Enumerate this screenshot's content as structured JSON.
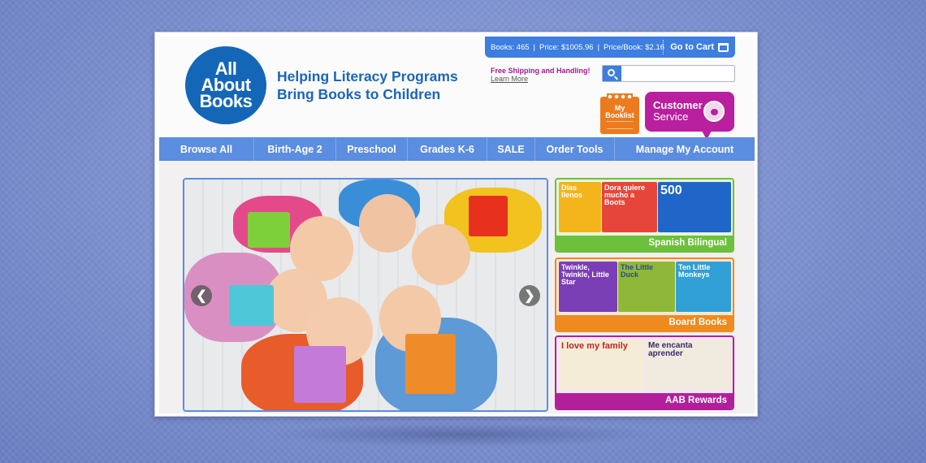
{
  "brand": {
    "logo_line1": "All",
    "logo_line2": "About",
    "logo_line3": "Books",
    "tagline_line1": "Helping Literacy Programs",
    "tagline_line2": "Bring Books to Children"
  },
  "cart": {
    "books_label": "Books: 465",
    "price_label": "Price: $1005.96",
    "price_per_book_label": "Price/Book: $2.16",
    "separator": "|",
    "go_to_cart": "Go to Cart"
  },
  "shipping": {
    "text": "Free Shipping and Handling!",
    "link": "Learn More"
  },
  "search": {
    "placeholder": "",
    "value": ""
  },
  "booklist": {
    "line1": "My",
    "line2": "Booklist"
  },
  "customer_service": {
    "line1": "Customer",
    "line2": "Service"
  },
  "nav": {
    "items": [
      {
        "label": "Browse All"
      },
      {
        "label": "Birth-Age 2"
      },
      {
        "label": "Preschool"
      },
      {
        "label": "Grades K-6"
      },
      {
        "label": "SALE"
      },
      {
        "label": "Order Tools"
      },
      {
        "label": "Manage My Account"
      }
    ]
  },
  "hero": {
    "prev": "❮",
    "next": "❯"
  },
  "tiles": [
    {
      "label": "Spanish Bilingual",
      "color": "#6cc03c"
    },
    {
      "label": "Board Books",
      "color": "#ef8a1f"
    },
    {
      "label": "AAB Rewards",
      "color": "#b21f9a"
    }
  ],
  "tile_covers": {
    "spanish_1": "Días llenos",
    "spanish_2": "Dora quiere mucho a Boots",
    "spanish_3": "500",
    "board_1": "Twinkle, Twinkle, Little Star",
    "board_2": "The Little Duck",
    "board_3": "Ten Little Monkeys",
    "rewards_1": "I love my family",
    "rewards_2": "Me encanta aprender"
  },
  "colors": {
    "primary_blue": "#1467b7",
    "nav_blue": "#5b8de0",
    "magenta": "#b91f9e",
    "orange": "#ec7b1f",
    "green": "#6cc03c"
  }
}
